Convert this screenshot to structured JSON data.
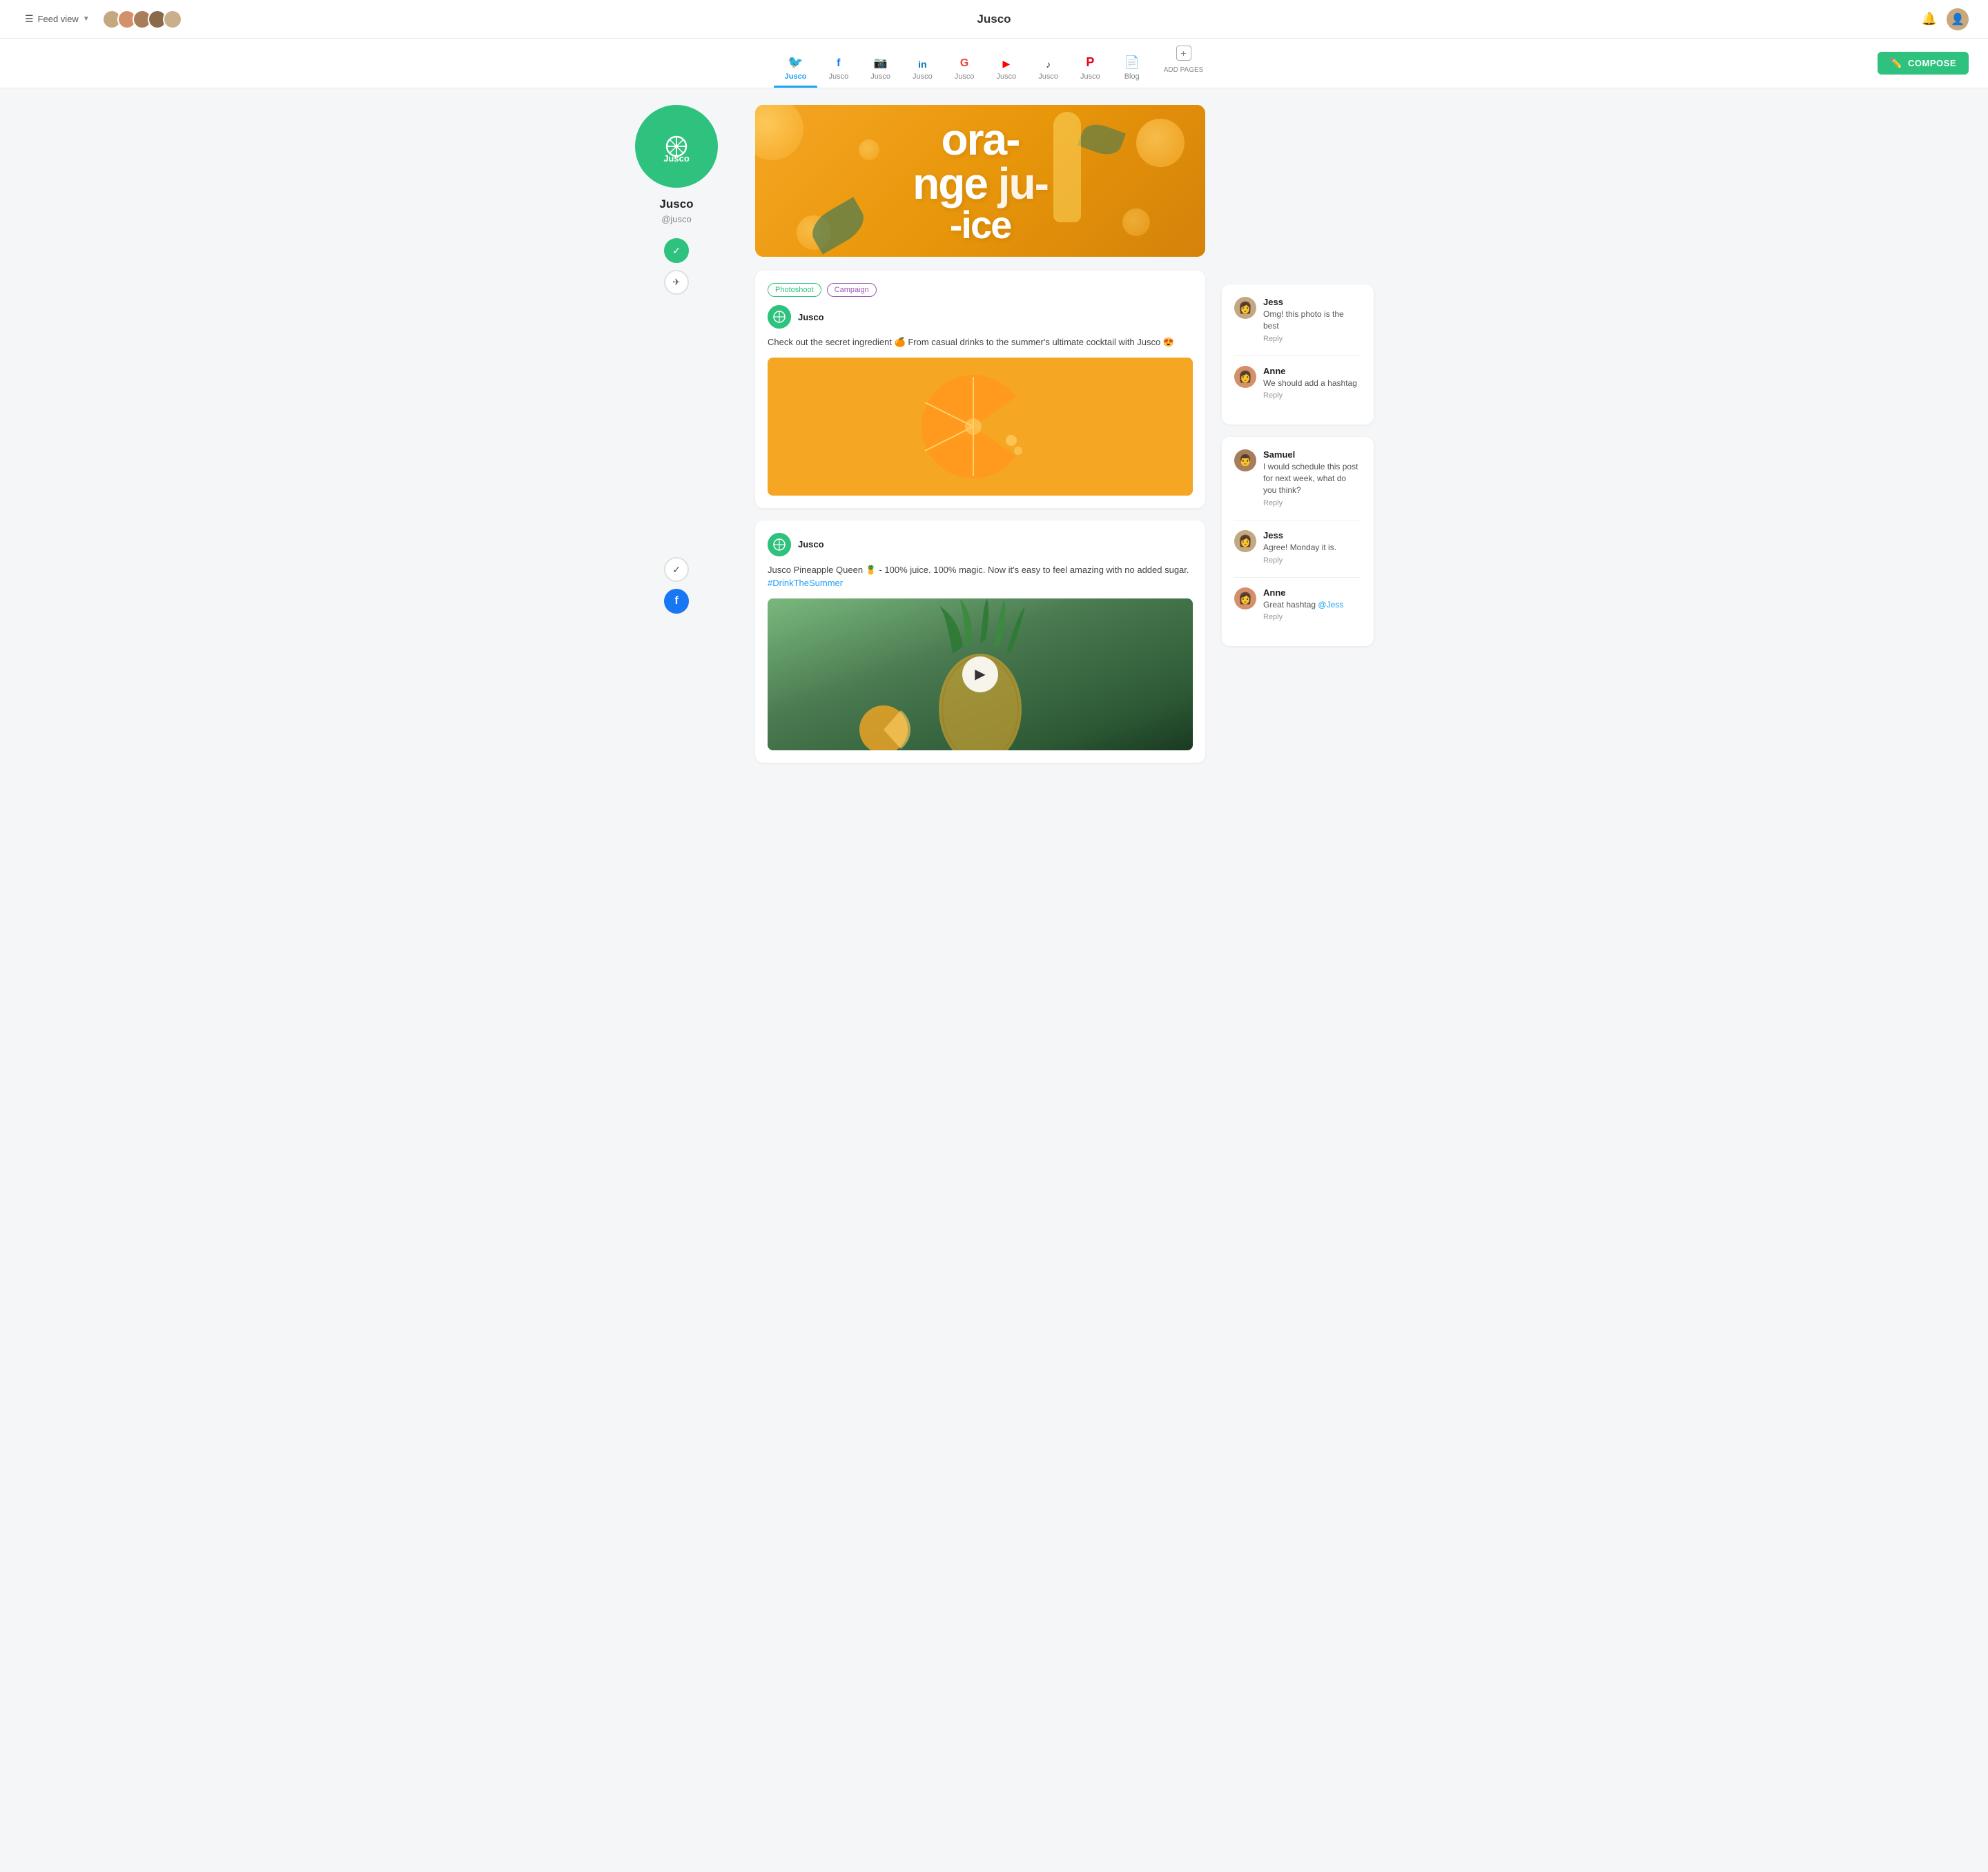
{
  "app": {
    "title": "Jusco"
  },
  "header": {
    "feed_view_label": "Feed view",
    "bell_title": "Notifications",
    "compose_label": "COMPOSE"
  },
  "nav": {
    "items": [
      {
        "id": "twitter",
        "label": "Jusco",
        "icon": "🐦",
        "active": true
      },
      {
        "id": "facebook",
        "label": "Jusco",
        "icon": "f",
        "active": false
      },
      {
        "id": "instagram",
        "label": "Jusco",
        "icon": "📷",
        "active": false
      },
      {
        "id": "linkedin",
        "label": "Jusco",
        "icon": "in",
        "active": false
      },
      {
        "id": "google",
        "label": "Jusco",
        "icon": "G",
        "active": false
      },
      {
        "id": "youtube",
        "label": "Jusco",
        "icon": "▶",
        "active": false
      },
      {
        "id": "tiktok",
        "label": "Jusco",
        "icon": "♪",
        "active": false
      },
      {
        "id": "pinterest",
        "label": "Jusco",
        "icon": "P",
        "active": false
      },
      {
        "id": "blog",
        "label": "Blog",
        "icon": "📄",
        "active": false
      },
      {
        "id": "add",
        "label": "ADD PAGES",
        "icon": "+",
        "active": false
      }
    ]
  },
  "profile": {
    "name": "Jusco",
    "handle": "@jusco",
    "logo": "🍊"
  },
  "banner": {
    "text_line1": "ora-",
    "text_line2": "nge",
    "text_line3": "ju-",
    "text_line4": "-ice"
  },
  "posts": [
    {
      "id": "post1",
      "tags": [
        "Photoshoot",
        "Campaign"
      ],
      "author": "Jusco",
      "text": "Check out the secret ingredient 🍊 From casual drinks to the summer's ultimate cocktail with Jusco 😍",
      "has_image": true,
      "approved": true
    },
    {
      "id": "post2",
      "tags": [],
      "author": "Jusco",
      "text": "Jusco Pineapple Queen 🍍 - 100% juice. 100% magic. Now it's easy to feel amazing with no added sugar. ",
      "hashtag": "#DrinkTheSummer",
      "has_video": true,
      "approved": false,
      "platform_icon": "facebook"
    }
  ],
  "comments_post1": [
    {
      "author": "Jess",
      "text": "Omg! this photo is the best",
      "reply_label": "Reply",
      "avatar_class": "av-jess"
    },
    {
      "author": "Anne",
      "text": "We should add a hashtag",
      "reply_label": "Reply",
      "avatar_class": "av-anne"
    }
  ],
  "comments_post2": [
    {
      "author": "Samuel",
      "text": "I would schedule this post for next week, what do you think?",
      "reply_label": "Reply",
      "avatar_class": "av-samuel"
    },
    {
      "author": "Jess",
      "text": "Agree! Monday it is.",
      "reply_label": "Reply",
      "avatar_class": "av-jess"
    },
    {
      "author": "Anne",
      "text": "Great hashtag ",
      "mention": "@Jess",
      "reply_label": "Reply",
      "avatar_class": "av-anne"
    }
  ],
  "actions": {
    "check_active": "✓",
    "send_icon": "✈",
    "check_inactive": "✓",
    "facebook_icon": "f"
  }
}
